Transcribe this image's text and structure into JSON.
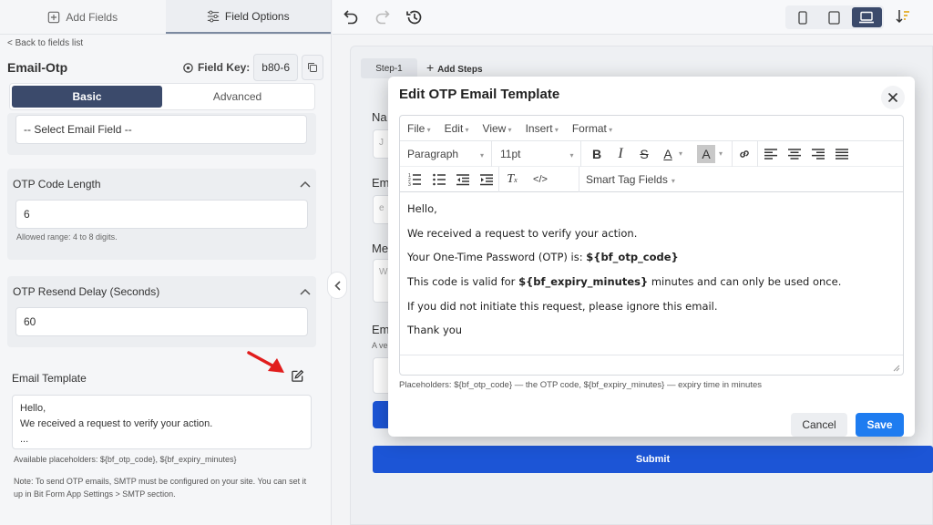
{
  "left": {
    "tabs": {
      "add_fields": "Add Fields",
      "field_options": "Field Options"
    },
    "back_link": "< Back to fields list",
    "field_title": "Email-Otp",
    "field_key_label": "Field Key:",
    "field_key_value": "b80-6",
    "seg": {
      "basic": "Basic",
      "advanced": "Advanced"
    },
    "select_email_field": "-- Select Email Field --",
    "otp_length": {
      "label": "OTP Code Length",
      "value": "6",
      "hint": "Allowed range: 4 to 8 digits."
    },
    "otp_resend": {
      "label": "OTP Resend Delay (Seconds)",
      "value": "60"
    },
    "email_template": {
      "label": "Email Template",
      "preview_line1": "Hello,",
      "preview_line2": "We received a request to verify your action.",
      "preview_line3": "...",
      "placeholders": "Available placeholders: ${bf_otp_code}, ${bf_expiry_minutes}",
      "note": "Note: To send OTP emails, SMTP must be configured on your site. You can set it up in Bit Form App Settings > SMTP section."
    }
  },
  "canvas": {
    "step_tab": "Step-1",
    "add_steps": "Add Steps",
    "bg_labels": [
      "Na",
      "Em",
      "Me",
      "Em"
    ],
    "bg_small_text": "A ve",
    "submit": "Submit"
  },
  "modal": {
    "title": "Edit OTP Email Template",
    "menus": [
      "File",
      "Edit",
      "View",
      "Insert",
      "Format"
    ],
    "block_select": "Paragraph",
    "size_select": "11pt",
    "smart_tags": "Smart Tag Fields",
    "content": {
      "line1": "Hello,",
      "line2": "We received a request to verify your action.",
      "line3_pre": "Your One-Time Password (OTP) is: ",
      "line3_code": "${bf_otp_code}",
      "line4_pre": "This code is valid for ",
      "line4_code": "${bf_expiry_minutes}",
      "line4_post": " minutes and can only be used once.",
      "line5": "If you did not initiate this request, please ignore this email.",
      "line6": "Thank you"
    },
    "placeholders_note": "Placeholders: ${bf_otp_code} — the OTP code, ${bf_expiry_minutes} — expiry time in minutes",
    "cancel": "Cancel",
    "save": "Save"
  },
  "colors": {
    "primary": "#1e7cf0",
    "submit_blue": "#1c55d6",
    "nav_dark": "#3b4a6b",
    "arrow_red": "#e11d1d"
  }
}
